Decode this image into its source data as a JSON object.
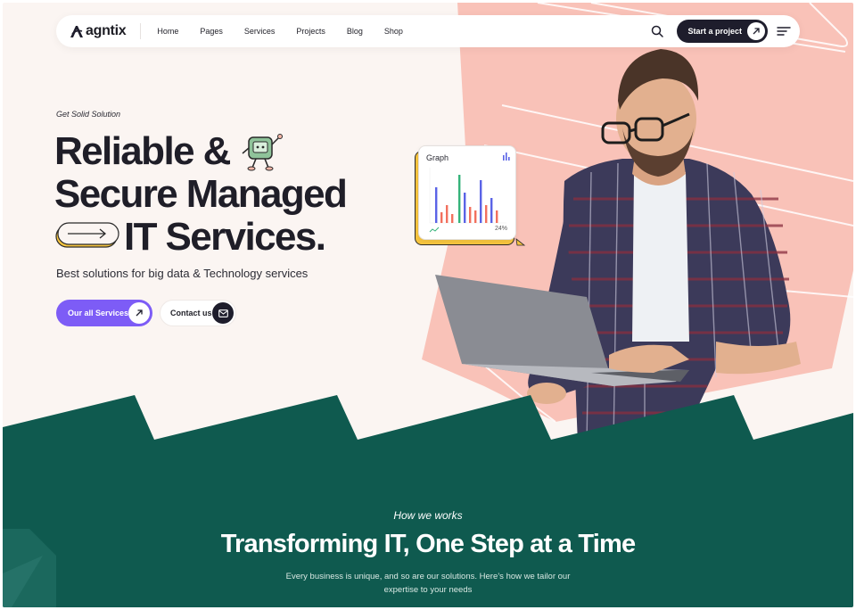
{
  "brand": {
    "name": "agntix"
  },
  "nav": {
    "items": [
      "Home",
      "Pages",
      "Services",
      "Projects",
      "Blog",
      "Shop"
    ],
    "cta_label": "Start a project"
  },
  "hero": {
    "eyebrow": "Get Solid Solution",
    "title_line1": "Reliable &",
    "title_line2": "Secure Managed",
    "title_line3": "IT Services.",
    "subtitle": "Best solutions for big data & Technology services",
    "primary_button": "Our all Services",
    "secondary_button": "Contact us"
  },
  "graph_card": {
    "title": "Graph",
    "percent": "24%"
  },
  "how": {
    "eyebrow": "How we works",
    "title": "Transforming IT, One Step at a Time",
    "description": "Every business is unique, and so are our solutions. Here’s how we tailor our expertise to your needs"
  },
  "colors": {
    "accent_purple": "#7d5cf6",
    "dark": "#1e1d2c",
    "green": "#0f5a4f",
    "pink": "#f9c2b8",
    "yellow": "#f7c53f"
  },
  "icons": [
    "search-icon",
    "arrow-up-right-icon",
    "hamburger-icon",
    "mail-icon",
    "arrow-right-icon",
    "bar-chart-icon",
    "trend-icon"
  ]
}
